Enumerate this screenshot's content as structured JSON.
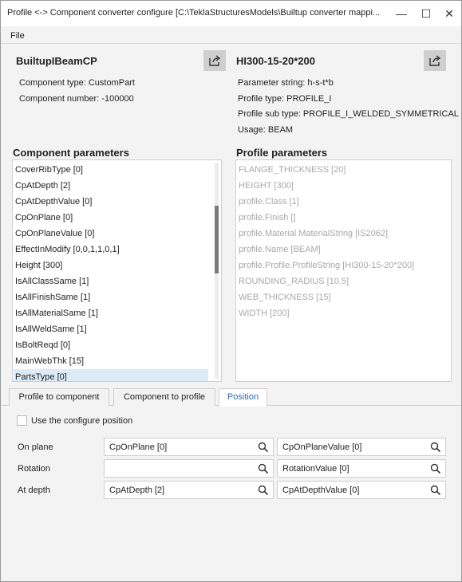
{
  "window": {
    "title": "Profile <-> Component converter configure [C:\\TeklaStructuresModels\\Builtup converter mappi...",
    "minimize": "—",
    "maximize": "☐",
    "close": "✕"
  },
  "menu": {
    "file": "File"
  },
  "component": {
    "name": "BuiltupIBeamCP",
    "type": "Component type: CustomPart",
    "number": "Component number: -100000"
  },
  "profile": {
    "name": "HI300-15-20*200",
    "parameter_string": "Parameter string: h-s-t*b",
    "type": "Profile type: PROFILE_I",
    "sub_type": "Profile sub type: PROFILE_I_WELDED_SYMMETRICAL",
    "usage": "Usage: BEAM"
  },
  "component_parameters": {
    "title": "Component parameters",
    "items": [
      "CoverRibType [0]",
      "CpAtDepth [2]",
      "CpAtDepthValue [0]",
      "CpOnPlane [0]",
      "CpOnPlaneValue [0]",
      "EffectInModify [0,0,1,1,0,1]",
      "Height [300]",
      "IsAllClassSame [1]",
      "IsAllFinishSame [1]",
      "IsAllMaterialSame [1]",
      "IsAllWeldSame [1]",
      "IsBoltReqd [0]",
      "MainWebThk [15]",
      "PartsType [0]"
    ],
    "selected": "PartsType [0]"
  },
  "profile_parameters": {
    "title": "Profile parameters",
    "items": [
      "FLANGE_THICKNESS [20]",
      "HEIGHT [300]",
      "profile.Class [1]",
      "profile.Finish []",
      "profile.Material.MaterialString [IS2062]",
      "profile.Name [BEAM]",
      "profile.Profile.ProfileString [HI300-15-20*200]",
      "ROUNDING_RADIUS [10.5]",
      "WEB_THICKNESS [15]",
      "WIDTH [200]"
    ]
  },
  "tabs": {
    "profile_to_component": "Profile to component",
    "component_to_profile": "Component to profile",
    "position": "Position",
    "active": "Position"
  },
  "position": {
    "use_configure_label": "Use the configure position",
    "use_configure_checked": false,
    "rows": [
      {
        "label": "On plane",
        "left": "CpOnPlane [0]",
        "right": "CpOnPlaneValue [0]"
      },
      {
        "label": "Rotation",
        "left": "",
        "right": "RotationValue [0]"
      },
      {
        "label": "At depth",
        "left": "CpAtDepth [2]",
        "right": "CpAtDepthValue [0]"
      }
    ]
  },
  "icons": {
    "export": "export-icon",
    "search": "search-icon"
  },
  "colors": {
    "selected_row": "#dcebf8",
    "active_tab_text": "#2a6cb3",
    "disabled_text": "#a8a8a8"
  }
}
